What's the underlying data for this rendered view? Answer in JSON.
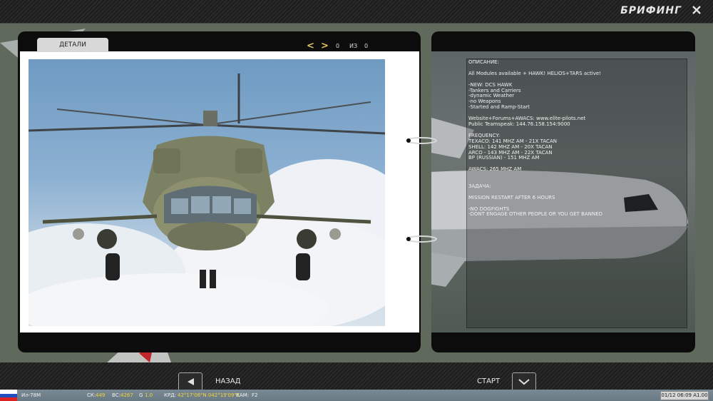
{
  "header": {
    "title": "БРИФИНГ"
  },
  "left_page": {
    "tab_label": "ДЕТАЛИ",
    "pager": {
      "current": "0",
      "of_label": "ИЗ",
      "total": "0"
    }
  },
  "briefing_lines": [
    "ОПИСАНИЕ:",
    "",
    "All Modules available + HAWK! HELIOS+TARS active!",
    "",
    "-NEW: DCS HAWK",
    "-Tankers and Carriers",
    "-dynamic Weather",
    "-no Weapons",
    "-Started and Ramp-Start",
    "",
    "Website+Forums+AWACS: www.elite-pilots.net",
    "Public Teamspeak: 144.76.158.154:9000",
    "",
    "FREQUENCY:",
    "TEXACO: 141 MHZ AM - 21X TACAN",
    "SHELL: 142 MHZ AM - 20X TACAN",
    "ARCO - 143 MHZ AM - 22X TACAN",
    "BP (RUSSIAN) - 151 MHZ AM",
    "",
    "AWACS: 265 MHZ AM",
    "",
    "",
    "ЗАДАЧА:",
    "",
    "MISSION RESTART AFTER 6 HOURS",
    "",
    "-NO DOGFIGHTS",
    "-DONT ENGAGE OTHER PEOPLE OR YOU GET BANNED"
  ],
  "footer": {
    "back_label": "НАЗАД",
    "start_label": "СТАРТ"
  },
  "status_bar": {
    "aircraft": "Ил-78M",
    "sk_label": "СК:",
    "sk_value": "449",
    "vs_label": "ВС:",
    "vs_value": "4267",
    "g_label": "G",
    "g_value": "1.0",
    "krd_label": "КРД:",
    "krd_value": "42°17'06\"N 042°19'09\"E",
    "kam_label": "КАМ:",
    "kam_value": "F2",
    "clock": "01/12 06:09 A1.00"
  },
  "colors": {
    "accent": "#e2c35a",
    "status_value": "#f5d232",
    "panel": "#0c0c0c"
  }
}
